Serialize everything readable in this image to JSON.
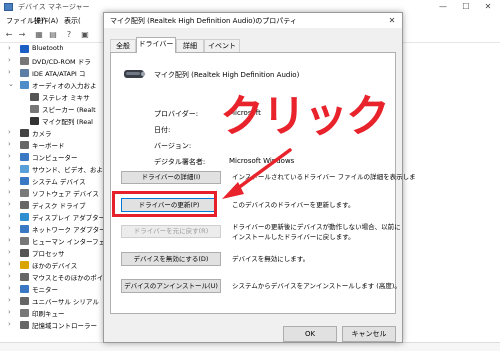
{
  "device_manager": {
    "title": "デバイス マネージャー",
    "menu": [
      "ファイル(F)",
      "操作(A)",
      "表示("
    ],
    "tree": [
      {
        "label": "Bluetooth",
        "expander": "›",
        "icon_color": "#1b5fc4"
      },
      {
        "label": "DVD/CD-ROM ドラ",
        "expander": "›",
        "icon_color": "#777777"
      },
      {
        "label": "IDE ATA/ATAPI コ",
        "expander": "›",
        "icon_color": "#5d7fa6"
      },
      {
        "label": "オーディオの入力およ",
        "expander": "⌄",
        "icon_color": "#4d8cc7"
      },
      {
        "label": "ステレオ ミキサ",
        "expander": "",
        "icon_color": "#555555"
      },
      {
        "label": "スピーカー (Realt",
        "expander": "",
        "icon_color": "#777777"
      },
      {
        "label": "マイク配列 (Real",
        "expander": "",
        "icon_color": "#333333"
      },
      {
        "label": "カメラ",
        "expander": "›",
        "icon_color": "#444444"
      },
      {
        "label": "キーボード",
        "expander": "›",
        "icon_color": "#666666"
      },
      {
        "label": "コンピューター",
        "expander": "›",
        "icon_color": "#3b78c4"
      },
      {
        "label": "サウンド、ビデオ、およびゲ",
        "expander": "›",
        "icon_color": "#5aa0d8"
      },
      {
        "label": "システム デバイス",
        "expander": "›",
        "icon_color": "#3b78c4"
      },
      {
        "label": "ソフトウェア デバイス",
        "expander": "›",
        "icon_color": "#7a7a7a"
      },
      {
        "label": "ディスク ドライブ",
        "expander": "›",
        "icon_color": "#666666"
      },
      {
        "label": "ディスプレイ アダプター",
        "expander": "›",
        "icon_color": "#2f8fd0"
      },
      {
        "label": "ネットワーク アダプター",
        "expander": "›",
        "icon_color": "#3b78c4"
      },
      {
        "label": "ヒューマン インターフェイ",
        "expander": "›",
        "icon_color": "#777777"
      },
      {
        "label": "プロセッサ",
        "expander": "›",
        "icon_color": "#555555"
      },
      {
        "label": "ほかのデバイス",
        "expander": "›",
        "icon_color": "#d9a400"
      },
      {
        "label": "マウスとそのほかのポイ",
        "expander": "›",
        "icon_color": "#666666"
      },
      {
        "label": "モニター",
        "expander": "›",
        "icon_color": "#3b78c4"
      },
      {
        "label": "ユニバーサル シリアル",
        "expander": "›",
        "icon_color": "#666666"
      },
      {
        "label": "印刷キュー",
        "expander": "›",
        "icon_color": "#777777"
      },
      {
        "label": "記憶域コントローラー",
        "expander": "›",
        "icon_color": "#666666"
      }
    ]
  },
  "dialog": {
    "title": "マイク配列 (Realtek High Definition Audio)のプロパティ",
    "close_glyph": "✕",
    "tabs": [
      "全般",
      "ドライバー",
      "詳細",
      "イベント"
    ],
    "device_name": "マイク配列 (Realtek High Definition Audio)",
    "fields": [
      {
        "label": "プロバイダー:",
        "value": "Microsoft"
      },
      {
        "label": "日付:",
        "value": ""
      },
      {
        "label": "バージョン:",
        "value": ""
      },
      {
        "label": "デジタル署名者:",
        "value": "Microsoft Windows"
      }
    ],
    "actions": [
      {
        "button": "ドライバーの詳細(I)",
        "description": "インストールされているドライバー ファイルの詳細を表示しま",
        "enabled": true
      },
      {
        "button": "ドライバーの更新(P)",
        "description": "このデバイスのドライバーを更新します。",
        "enabled": true
      },
      {
        "button": "ドライバーを元に戻す(R)",
        "description_lines": [
          "ドライバーの更新後にデバイスが動作しない場合、以前に",
          "インストールしたドライバーに戻します。"
        ],
        "enabled": false
      },
      {
        "button": "デバイスを無効にする(D)",
        "description": "デバイスを無効にします。",
        "enabled": true
      },
      {
        "button": "デバイスのアンインストール(U)",
        "description": "システムからデバイスをアンインストールします (高度)。",
        "enabled": true
      }
    ],
    "ok_label": "OK",
    "cancel_label": "キャンセル"
  },
  "annotation": {
    "text": "クリック",
    "color": "#e8232b"
  },
  "colors": {
    "highlight": "#e5202a",
    "dialog_bg": "#f0f0f0",
    "button_bg": "#e1e1e1"
  }
}
